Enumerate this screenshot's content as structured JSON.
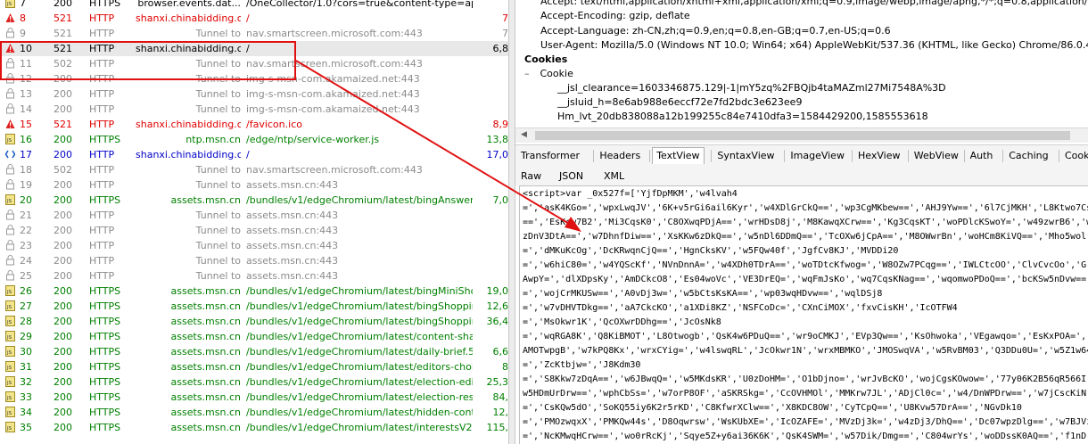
{
  "sessions": [
    {
      "id": "7",
      "result": "200",
      "protocol": "HTTPS",
      "host": "browser.events.dat...",
      "url": "/OneCollector/1.0?cors=true&content-type=ap...",
      "body": "",
      "color": "black",
      "icon": "script-icon",
      "selected": false
    },
    {
      "id": "8",
      "result": "521",
      "protocol": "HTTP",
      "host": "shanxi.chinabidding.cc",
      "url": "/",
      "body": "7",
      "color": "red",
      "icon": "error-icon",
      "selected": false
    },
    {
      "id": "9",
      "result": "521",
      "protocol": "HTTP",
      "host": "Tunnel to",
      "url": "nav.smartscreen.microsoft.com:443",
      "body": "7",
      "color": "gray",
      "icon": "lock-icon",
      "selected": false
    },
    {
      "id": "10",
      "result": "521",
      "protocol": "HTTP",
      "host": "shanxi.chinabidding.cc",
      "url": "/",
      "body": "6,8",
      "color": "black",
      "icon": "error-icon",
      "selected": true
    },
    {
      "id": "11",
      "result": "502",
      "protocol": "HTTP",
      "host": "Tunnel to",
      "url": "nav.smartscreen.microsoft.com:443",
      "body": "",
      "color": "gray",
      "icon": "lock-icon",
      "selected": false
    },
    {
      "id": "12",
      "result": "200",
      "protocol": "HTTP",
      "host": "Tunnel to",
      "url": "img-s-msn-com.akamaized.net:443",
      "body": "",
      "color": "gray",
      "icon": "lock-icon",
      "selected": false
    },
    {
      "id": "13",
      "result": "200",
      "protocol": "HTTP",
      "host": "Tunnel to",
      "url": "img-s-msn-com.akamaized.net:443",
      "body": "",
      "color": "gray",
      "icon": "lock-icon",
      "selected": false
    },
    {
      "id": "14",
      "result": "200",
      "protocol": "HTTP",
      "host": "Tunnel to",
      "url": "img-s-msn-com.akamaized.net:443",
      "body": "",
      "color": "gray",
      "icon": "lock-icon",
      "selected": false
    },
    {
      "id": "15",
      "result": "521",
      "protocol": "HTTP",
      "host": "shanxi.chinabidding.cc",
      "url": "/favicon.ico",
      "body": "8,9",
      "color": "red",
      "icon": "error-icon",
      "selected": false
    },
    {
      "id": "16",
      "result": "200",
      "protocol": "HTTPS",
      "host": "ntp.msn.cn",
      "url": "/edge/ntp/service-worker.js",
      "body": "13,8",
      "color": "green",
      "icon": "script-icon",
      "selected": false
    },
    {
      "id": "17",
      "result": "200",
      "protocol": "HTTP",
      "host": "shanxi.chinabidding.cc",
      "url": "/",
      "body": "17,0",
      "color": "blue",
      "icon": "html-icon",
      "selected": false
    },
    {
      "id": "18",
      "result": "502",
      "protocol": "HTTP",
      "host": "Tunnel to",
      "url": "nav.smartscreen.microsoft.com:443",
      "body": "",
      "color": "gray",
      "icon": "lock-icon",
      "selected": false
    },
    {
      "id": "19",
      "result": "200",
      "protocol": "HTTP",
      "host": "Tunnel to",
      "url": "assets.msn.cn:443",
      "body": "",
      "color": "gray",
      "icon": "lock-icon",
      "selected": false
    },
    {
      "id": "20",
      "result": "200",
      "protocol": "HTTPS",
      "host": "assets.msn.cn",
      "url": "/bundles/v1/edgeChromium/latest/bingAnswers...",
      "body": "7,0",
      "color": "green",
      "icon": "script-icon",
      "selected": false
    },
    {
      "id": "21",
      "result": "200",
      "protocol": "HTTP",
      "host": "Tunnel to",
      "url": "assets.msn.cn:443",
      "body": "",
      "color": "gray",
      "icon": "lock-icon",
      "selected": false
    },
    {
      "id": "22",
      "result": "200",
      "protocol": "HTTP",
      "host": "Tunnel to",
      "url": "assets.msn.cn:443",
      "body": "",
      "color": "gray",
      "icon": "lock-icon",
      "selected": false
    },
    {
      "id": "23",
      "result": "200",
      "protocol": "HTTP",
      "host": "Tunnel to",
      "url": "assets.msn.cn:443",
      "body": "",
      "color": "gray",
      "icon": "lock-icon",
      "selected": false
    },
    {
      "id": "24",
      "result": "200",
      "protocol": "HTTP",
      "host": "Tunnel to",
      "url": "assets.msn.cn:443",
      "body": "",
      "color": "gray",
      "icon": "lock-icon",
      "selected": false
    },
    {
      "id": "25",
      "result": "200",
      "protocol": "HTTP",
      "host": "Tunnel to",
      "url": "assets.msn.cn:443",
      "body": "",
      "color": "gray",
      "icon": "lock-icon",
      "selected": false
    },
    {
      "id": "26",
      "result": "200",
      "protocol": "HTTPS",
      "host": "assets.msn.cn",
      "url": "/bundles/v1/edgeChromium/latest/bingMiniShop...",
      "body": "19,0",
      "color": "green",
      "icon": "script-icon",
      "selected": false
    },
    {
      "id": "27",
      "result": "200",
      "protocol": "HTTPS",
      "host": "assets.msn.cn",
      "url": "/bundles/v1/edgeChromium/latest/bingShoppin...",
      "body": "12,6",
      "color": "green",
      "icon": "script-icon",
      "selected": false
    },
    {
      "id": "28",
      "result": "200",
      "protocol": "HTTPS",
      "host": "assets.msn.cn",
      "url": "/bundles/v1/edgeChromium/latest/bingShoppin...",
      "body": "36,4",
      "color": "green",
      "icon": "script-icon",
      "selected": false
    },
    {
      "id": "29",
      "result": "200",
      "protocol": "HTTPS",
      "host": "assets.msn.cn",
      "url": "/bundles/v1/edgeChromium/latest/content-shar...",
      "body": "",
      "color": "green",
      "icon": "script-icon",
      "selected": false
    },
    {
      "id": "30",
      "result": "200",
      "protocol": "HTTPS",
      "host": "assets.msn.cn",
      "url": "/bundles/v1/edgeChromium/latest/daily-brief.5...",
      "body": "6,6",
      "color": "green",
      "icon": "script-icon",
      "selected": false
    },
    {
      "id": "31",
      "result": "200",
      "protocol": "HTTPS",
      "host": "assets.msn.cn",
      "url": "/bundles/v1/edgeChromium/latest/editors-choic...",
      "body": "8",
      "color": "green",
      "icon": "script-icon",
      "selected": false
    },
    {
      "id": "32",
      "result": "200",
      "protocol": "HTTPS",
      "host": "assets.msn.cn",
      "url": "/bundles/v1/edgeChromium/latest/election-edit...",
      "body": "25,3",
      "color": "green",
      "icon": "script-icon",
      "selected": false
    },
    {
      "id": "33",
      "result": "200",
      "protocol": "HTTPS",
      "host": "assets.msn.cn",
      "url": "/bundles/v1/edgeChromium/latest/election-resu...",
      "body": "84,",
      "color": "green",
      "icon": "script-icon",
      "selected": false
    },
    {
      "id": "34",
      "result": "200",
      "protocol": "HTTPS",
      "host": "assets.msn.cn",
      "url": "/bundles/v1/edgeChromium/latest/hidden-conte...",
      "body": "12,",
      "color": "green",
      "icon": "script-icon",
      "selected": false
    },
    {
      "id": "35",
      "result": "200",
      "protocol": "HTTPS",
      "host": "assets.msn.cn",
      "url": "/bundles/v1/edgeChromium/latest/interestsV2...",
      "body": "115,",
      "color": "green",
      "icon": "script-icon",
      "selected": false
    }
  ],
  "request_headers": {
    "accept": "Accept: text/html,application/xhtml+xml,application/xml;q=0.9,image/webp,image/apng,*/*;q=0.8,application/signed-exchange",
    "accept_encoding": "Accept-Encoding: gzip, deflate",
    "accept_language": "Accept-Language: zh-CN,zh;q=0.9,en;q=0.8,en-GB;q=0.7,en-US;q=0.6",
    "user_agent": "User-Agent: Mozilla/5.0 (Windows NT 10.0; Win64; x64) AppleWebKit/537.36 (KHTML, like Gecko) Chrome/86.0.4240.80 Safari/",
    "cookies_heading": "Cookies",
    "cookie_label": "Cookie",
    "cookie_values": [
      "__jsl_clearance=1603346875.129|-1|mY5zq%2FBQjb4taMAZml27Mi7548A%3D",
      "__jsluid_h=8e6ab988e6eccf72e7fd2bdc3e623ee9",
      "Hm_lvt_20db838088a12b199255c84e7410dfa3=1584429200,1585553618"
    ]
  },
  "response_tabs_row1": [
    "Transformer",
    "Headers",
    "TextView",
    "SyntaxView",
    "ImageView",
    "HexView",
    "WebView",
    "Auth",
    "Caching",
    "Cookies"
  ],
  "response_tabs_row2": [
    "Raw",
    "JSON",
    "XML"
  ],
  "active_tab": "TextView",
  "textview_lines": [
    "<script>var _0x527f=['YjfDpMKM','w4lvah4",
    "=','asK4KGo=','wpxLwqJV','6K+v5rGi6ail6Kyr','w4XDlGrCkQ==','wp3CgMKbew==','AHJ9Yw==','6l7CjMKH','L8Ktwo7Cs",
    "==','EsKcw7B2','Mi3CqsK0','C8OXwqPDjA==','wrHDsD8j','M8KawqXCrw==','Kg3CqsKT','woPDlcKSwoY=','w49zwrB6','w",
    "zDnV3DtA==','w7DhnfDiw==','XsKKw6zDkQ==','w5nDl6DDmQ==','TcOXw6jCpA==','M8OWwrBn','woHCm8KiVQ==','Mho5wol",
    "=','dMKuKcOg','DcKRwqnCjQ==','HgnCksKV','w5FQw40f','JgfCv8KJ','MVDDi20",
    "=','w6hiC80=','w4YQScKf','NVnDnnA=','w4XDh0TDrA==','woTDtcKfwog=','W8OZw7PCqg==','IWLCtcOO','ClvCvcOo','G",
    "AwpY=','dlXDpsKy','AmDCkcO8','Es04woVc','VE3DrEQ=','wqFmJsKo','wq7CqsKNag==','wqomwoPDoQ==','bcKSw5nDvw==",
    "=','wojCrMKUSw==','A0vDj3w=','w5bCtsKsKA==','wp03wqHDvw==','wqlDSj8",
    "=','w7vDHVTDkg==','aA7CkcKO','a1XDi8KZ','NSFCoDc=','CXnCiMOX','fxvCisKH','IcOTFW4",
    "=','MsOkwr1K','QcOXwrDDhg==','JcOsNk8",
    "=','wqRGA8K','Q8KiBMOT','L8Otwogb','QsK4w6PDuQ==','wr9oCMKJ','EVp3Qw==','KsOhwoka','VEgawqo=','EsKxPOA=','",
    "AMOTwpgB','w7kPQ8Kx','wrxCYig=','w4lswqRL','JcOkwr1N','wrxMBMKO','JMOSwqVA','w5RvBM03','Q3DDu0U=','w5Z1w64",
    "=','ZcKtbjw=','J8Kdm30",
    "=','S8Kkw7zDqA==','w6JBwqQ=','w5MKdsKR','U0zDoHM=','O1bDjno=','wrJvBcKO','wojCgsKOwow=','77y06K2B56qR566I'",
    "w5HDmUrDrw==','wphCbSs=','w7orP8OF','aSKRSkg=','CcOVHMOl','MMKrw7JL','ADjCl0c=','w4/DnWPDrw==','w7jCscKiN",
    "=','CsKQw5dO','SoKQ55iy6K2r5rKD','C8KfwrXClw==','X8KDC8OW','CyTCpQ==','U8Kvw57DrA==','NGvDk10",
    "=','PMOzwqxX','PMKQw44s','D8Oqwrsw','WsKUbXE=','IcOZAFE=','MVzDj3k=','w4zDj3/DhQ==','Dc07wpzDlg==','w7BJVi",
    "=','NcKMwqHCrw==','wo0rRcKj','Sqye5Z+y6ai36K6K','QsK4SWM=','w57Dik/Dmg==','C804wrYs','woDDssK0AQ==','f1nD",
    "o=','w5Z+Bc09','wqdCbis=','J8KkwovCqA==','wrzDrggF','MOB9w5s=','w5ZrHMO5','w5BEOcOB','RMKBCMOu','DTHCgh=='"
  ],
  "colors": {
    "http_error": "#e00000",
    "https_ok": "#008000",
    "html_blue": "#0000c8",
    "tunnel_gray": "#8c8c8c",
    "annotation_red": "#e01010"
  }
}
